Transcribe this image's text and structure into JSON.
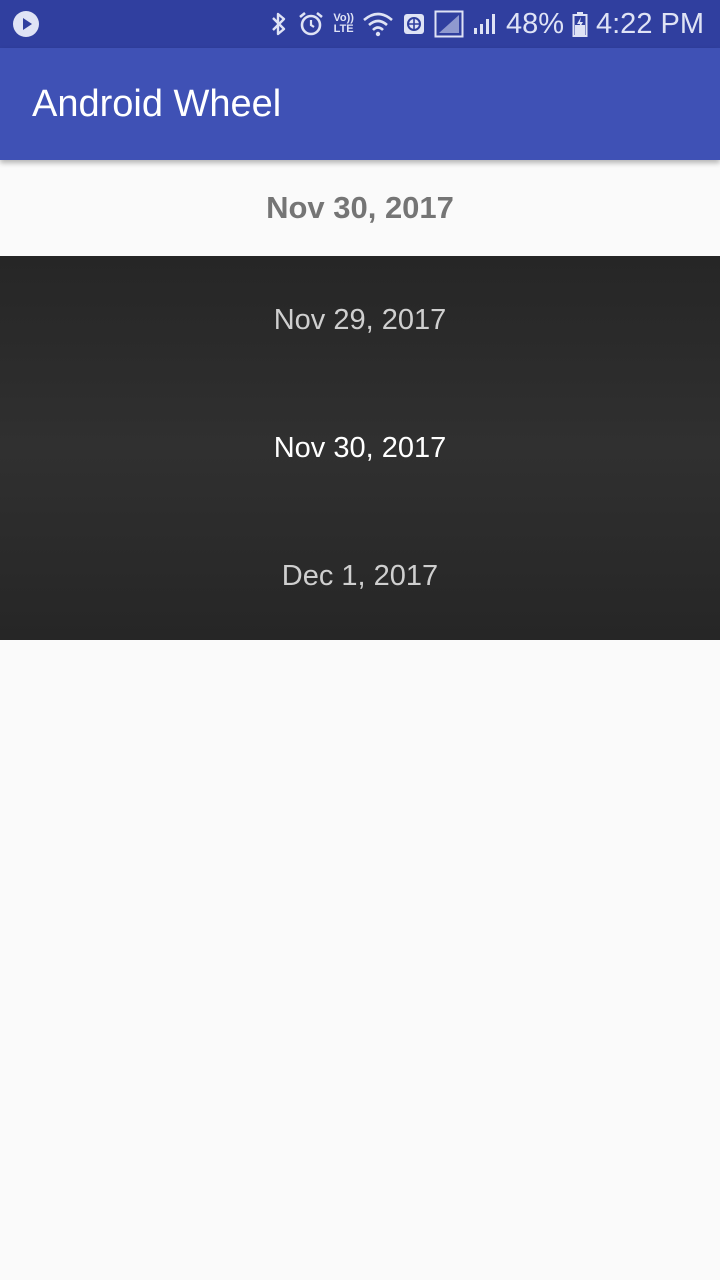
{
  "status_bar": {
    "battery_percent": "48%",
    "time": "4:22 PM",
    "volte_top": "Vo))",
    "volte_bottom": "LTE",
    "icons": [
      "play-icon",
      "bluetooth-icon",
      "alarm-icon",
      "volte-icon",
      "wifi-icon",
      "data-saver-icon",
      "signal-icon",
      "signal-icon-2",
      "battery-icon"
    ]
  },
  "app_bar": {
    "title": "Android Wheel",
    "background": "#3f51b5"
  },
  "selected_date": "Nov 30, 2017",
  "wheel": {
    "items": [
      "Nov 29, 2017",
      "Nov 30, 2017",
      "Dec 1, 2017"
    ],
    "current_index": 1
  }
}
